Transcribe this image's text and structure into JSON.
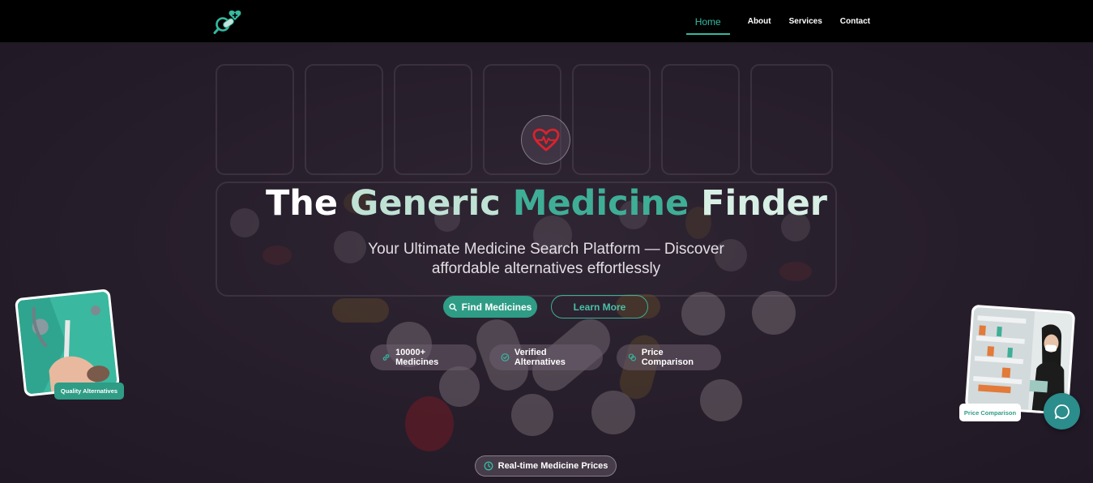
{
  "nav": {
    "logo_icon": "magnifier-pill-heart-icon",
    "items": [
      {
        "label": "Home",
        "active": true
      },
      {
        "label": "About"
      },
      {
        "label": "Services"
      },
      {
        "label": "Contact"
      }
    ]
  },
  "hero": {
    "badge_icon": "heart-pulse-icon",
    "title": {
      "part1": "The ",
      "part2": "Generic ",
      "part3": "Medicine ",
      "part4": "Finder"
    },
    "subtitle_line1": "Your Ultimate Medicine Search Platform — Discover",
    "subtitle_line2": "affordable alternatives effortlessly",
    "find_button": "Find Medicines",
    "learn_button": "Learn More",
    "features": [
      {
        "label": "10000+ Medicines",
        "icon": "link-icon"
      },
      {
        "label": "Verified Alternatives",
        "icon": "check-circle-icon"
      },
      {
        "label": "Price Comparison",
        "icon": "coins-icon"
      }
    ],
    "realtime_label": "Real-time Medicine Prices"
  },
  "side_cards": {
    "left_tag": "Quality Alternatives",
    "right_tag": "Price Comparison"
  },
  "colors": {
    "accent": "#35b9a0",
    "button": "#2f9c86",
    "heart": "#d8232e",
    "nav_bg": "#000000"
  }
}
